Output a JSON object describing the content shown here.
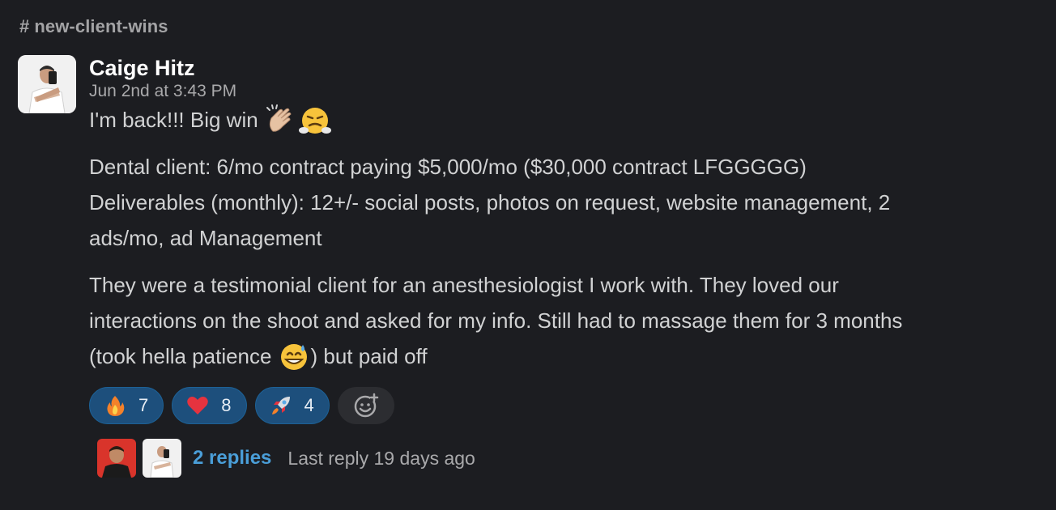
{
  "channel": {
    "name": "new-client-wins"
  },
  "message": {
    "author": "Caige Hitz",
    "timestamp": "Jun 2nd at 3:43 PM",
    "line1_text": "I'm back!!! Big win",
    "line1_emojis": [
      "clap-icon",
      "triumph-face-icon"
    ],
    "para2": [
      "Dental client: 6/mo contract paying $5,000/mo ($30,000 contract LFGGGGG)",
      "Deliverables (monthly): 12+/- social posts, photos on request, website management, 2",
      "ads/mo, ad Management"
    ],
    "para3_line1": "They were a testimonial client for an anesthesiologist I work with. They loved our",
    "para3_line2": "interactions on the shoot and asked for my info. Still had to massage them for 3 months",
    "para3_line3_a": "(took hella patience",
    "para3_line3_b": ") but paid off",
    "para3_emoji": "grinning-sweat-icon"
  },
  "reactions": [
    {
      "icon": "fire-icon",
      "count": "7"
    },
    {
      "icon": "heart-icon",
      "count": "8"
    },
    {
      "icon": "rocket-icon",
      "count": "4"
    }
  ],
  "thread": {
    "replies": "2 replies",
    "last_reply": "Last reply 19 days ago"
  },
  "colors": {
    "background": "#1c1d21",
    "reaction_bg": "#1d4f7c",
    "link": "#4a9ed8"
  }
}
